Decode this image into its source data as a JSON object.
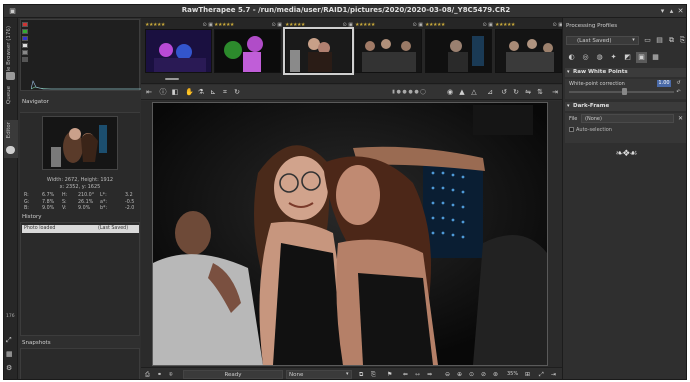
{
  "window": {
    "title": "RawTherapee 5.7 - /run/media/user/RAID1/pictures/2020/2020-03-08/_Y8C5479.CR2",
    "btn_min": "▾",
    "btn_max": "▴",
    "btn_close": "✕"
  },
  "vtabs": {
    "file_browser": "File Browser (176)",
    "queue": "Queue",
    "editor": "Editor",
    "count": "176"
  },
  "left_panel": {
    "navigator_title": "Navigator",
    "nav_size": "Width: 2672, Height: 1912",
    "nav_coords": "x: 2352, y: 1625",
    "info": {
      "rows": [
        {
          "a": "R:",
          "b": "6.7%",
          "c": "H:",
          "d": "210.0°",
          "e": "L*:",
          "f": "3.2"
        },
        {
          "a": "G:",
          "b": "7.8%",
          "c": "S:",
          "d": "26.1%",
          "e": "a*:",
          "f": "-0.5"
        },
        {
          "a": "B:",
          "b": "9.0%",
          "c": "V:",
          "d": "9.0%",
          "e": "b*:",
          "f": "-2.0"
        }
      ]
    },
    "history_title": "History",
    "history_col1": "Photo loaded",
    "history_col2": "(Last Saved)",
    "snapshots_title": "Snapshots",
    "snap_add": "+",
    "snap_remove": "−"
  },
  "filmstrip": {
    "stars": "★★★★★"
  },
  "bottom": {
    "status": "Ready",
    "none_select": "None",
    "zoom": "35%"
  },
  "right_panel": {
    "profiles_title": "Processing Profiles",
    "profile_value": "(Last Saved)",
    "raw_white_points": "Raw White Points",
    "white_point_label": "White-point correction",
    "white_point_value": "1.00",
    "white_point_fraction": 0.5,
    "dark_frame": "Dark-Frame",
    "file_label": "File",
    "file_value": "(None)",
    "auto_selection": "Auto-selection"
  },
  "colors": {
    "accent": "#4a6aa8",
    "star": "#c9a93a"
  }
}
